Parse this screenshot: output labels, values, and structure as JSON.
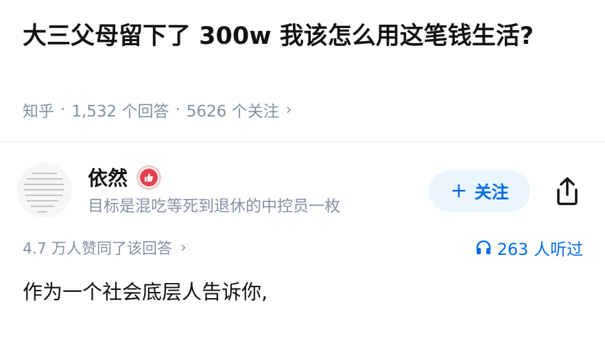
{
  "question": {
    "title": "大三父母留下了 300w 我该怎么用这笔钱生活?",
    "source": "知乎",
    "answer_count": "1,532 个回答",
    "follower_count": "5626 个关注",
    "separator": "·",
    "chevron": "›"
  },
  "author": {
    "name": "依然",
    "bio": "目标是混吃等死到退休的中控员一枚",
    "badge_icon": "thumbs-up-badge-icon",
    "follow_label": "关注",
    "follow_plus": "+"
  },
  "answer": {
    "votes_text": "4.7 万人赞同了该回答",
    "votes_chevron": "›",
    "listen_text": "263 人听过",
    "first_line": "作为一个社会底层人告诉你,"
  },
  "colors": {
    "accent": "#056de8",
    "follow_bg": "#ebf5ff",
    "meta_gray": "#8590a6",
    "badge_red": "#e2404e",
    "text": "#121212"
  },
  "icons": {
    "share": "share-icon",
    "headphones": "headphones-icon",
    "chevron": "chevron-right-icon"
  }
}
